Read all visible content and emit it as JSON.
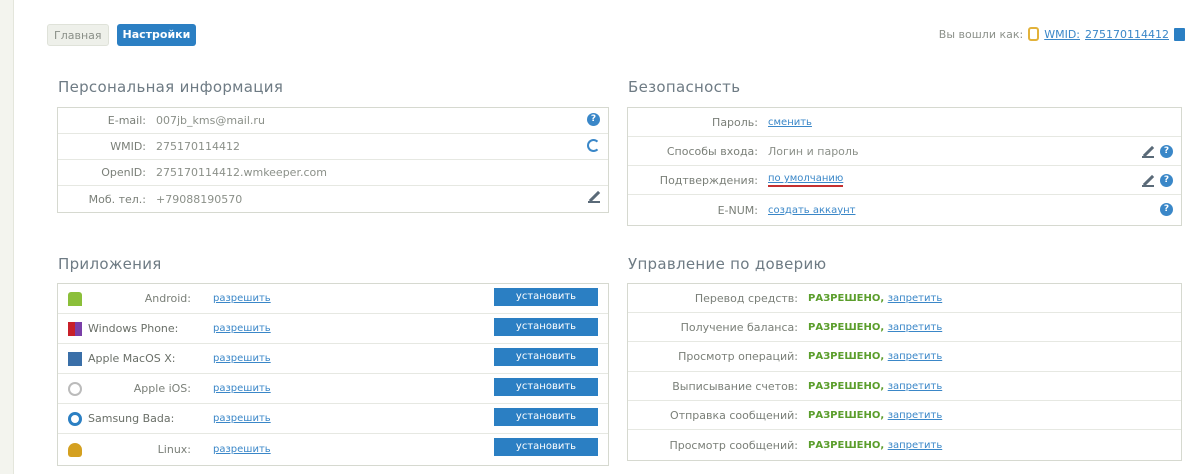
{
  "tabs": [
    "Главная",
    "Настройки"
  ],
  "login": {
    "label": "Вы вошли как:",
    "wmid_label": "WMID:",
    "wmid_value": "275170114412"
  },
  "personal": {
    "title": "Персональная информация",
    "rows": [
      {
        "label": "E-mail:",
        "value": "007jb_kms@mail.ru"
      },
      {
        "label": "WMID:",
        "value": "275170114412"
      },
      {
        "label": "OpenID:",
        "value": "275170114412.wmkeeper.com"
      },
      {
        "label": "Моб. тел.:",
        "value": "+79088190570"
      }
    ]
  },
  "security": {
    "title": "Безопасность",
    "rows": [
      {
        "label": "Пароль:",
        "value": "сменить"
      },
      {
        "label": "Способы входа:",
        "value": "Логин и пароль"
      },
      {
        "label": "Подтверждения:",
        "value": "по умолчанию"
      },
      {
        "label": "E-NUM:",
        "value": "создать аккаунт"
      }
    ]
  },
  "apps": {
    "title": "Приложения",
    "allow": "разрешить",
    "install": "установить",
    "items": [
      {
        "name": "Android:",
        "icon": "android-icon",
        "color": "#8bbf3a"
      },
      {
        "name": "Windows Phone:",
        "icon": "windows-icon",
        "color": "#7a3fa8"
      },
      {
        "name": "Apple MacOS X:",
        "icon": "macos-icon",
        "color": "#3a6fa8"
      },
      {
        "name": "Apple iOS:",
        "icon": "apple-icon",
        "color": "#bbbbbb"
      },
      {
        "name": "Samsung Bada:",
        "icon": "bada-icon",
        "color": "#2b7fc3"
      },
      {
        "name": "Linux:",
        "icon": "linux-icon",
        "color": "#d4a020"
      }
    ]
  },
  "trust": {
    "title": "Управление по доверию",
    "allowed": "РАЗРЕШЕНО,",
    "deny": "запретить",
    "rows": [
      "Перевод средств:",
      "Получение баланса:",
      "Просмотр операций:",
      "Выписывание счетов:",
      "Отправка сообщений:",
      "Просмотр сообщений:"
    ]
  }
}
